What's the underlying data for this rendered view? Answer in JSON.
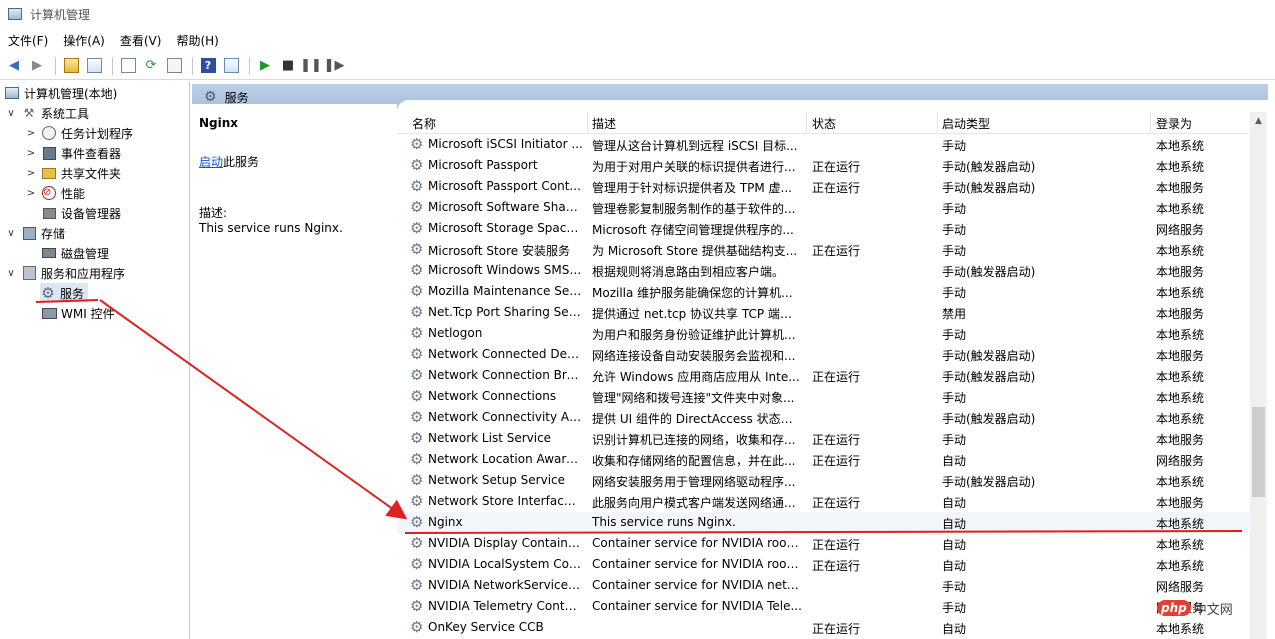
{
  "window": {
    "title": "计算机管理"
  },
  "menu": [
    "文件(F)",
    "操作(A)",
    "查看(V)",
    "帮助(H)"
  ],
  "tree": {
    "root": "计算机管理(本地)",
    "system_tools": "系统工具",
    "task_scheduler": "任务计划程序",
    "event_viewer": "事件查看器",
    "shared_folders": "共享文件夹",
    "performance": "性能",
    "device_manager": "设备管理器",
    "storage": "存储",
    "disk_management": "磁盘管理",
    "services_apps": "服务和应用程序",
    "services": "服务",
    "wmi": "WMI 控件"
  },
  "panel_header": "服务",
  "details": {
    "service_name": "Nginx",
    "start_link": "启动",
    "start_suffix": "此服务",
    "desc_label": "描述:",
    "desc_text": "This service runs Nginx."
  },
  "columns": {
    "name": "名称",
    "desc": "描述",
    "status": "状态",
    "startup": "启动类型",
    "logon": "登录为"
  },
  "services": [
    {
      "name": "Microsoft iSCSI Initiator ...",
      "desc": "管理从这台计算机到远程 iSCSI 目标...",
      "status": "",
      "startup": "手动",
      "logon": "本地系统"
    },
    {
      "name": "Microsoft Passport",
      "desc": "为用于对用户关联的标识提供者进行...",
      "status": "正在运行",
      "startup": "手动(触发器启动)",
      "logon": "本地系统"
    },
    {
      "name": "Microsoft Passport Cont...",
      "desc": "管理用于针对标识提供者及 TPM 虚...",
      "status": "正在运行",
      "startup": "手动(触发器启动)",
      "logon": "本地服务"
    },
    {
      "name": "Microsoft Software Shad...",
      "desc": "管理卷影复制服务制作的基于软件的...",
      "status": "",
      "startup": "手动",
      "logon": "本地系统"
    },
    {
      "name": "Microsoft Storage Space...",
      "desc": "Microsoft 存储空间管理提供程序的...",
      "status": "",
      "startup": "手动",
      "logon": "网络服务"
    },
    {
      "name": "Microsoft Store 安装服务",
      "desc": "为 Microsoft Store 提供基础结构支...",
      "status": "正在运行",
      "startup": "手动",
      "logon": "本地系统"
    },
    {
      "name": "Microsoft Windows SMS ...",
      "desc": "根据规则将消息路由到相应客户端。",
      "status": "",
      "startup": "手动(触发器启动)",
      "logon": "本地服务"
    },
    {
      "name": "Mozilla Maintenance Ser...",
      "desc": "Mozilla 维护服务能确保您的计算机...",
      "status": "",
      "startup": "手动",
      "logon": "本地系统"
    },
    {
      "name": "Net.Tcp Port Sharing Ser...",
      "desc": "提供通过 net.tcp 协议共享 TCP 端口...",
      "status": "",
      "startup": "禁用",
      "logon": "本地服务"
    },
    {
      "name": "Netlogon",
      "desc": "为用户和服务身份验证维护此计算机...",
      "status": "",
      "startup": "手动",
      "logon": "本地系统"
    },
    {
      "name": "Network Connected Devi...",
      "desc": "网络连接设备自动安装服务会监视和...",
      "status": "",
      "startup": "手动(触发器启动)",
      "logon": "本地服务"
    },
    {
      "name": "Network Connection Bro...",
      "desc": "允许 Windows 应用商店应用从 Inte...",
      "status": "正在运行",
      "startup": "手动(触发器启动)",
      "logon": "本地系统"
    },
    {
      "name": "Network Connections",
      "desc": "管理\"网络和拨号连接\"文件夹中对象...",
      "status": "",
      "startup": "手动",
      "logon": "本地系统"
    },
    {
      "name": "Network Connectivity Ass...",
      "desc": "提供 UI 组件的 DirectAccess 状态通...",
      "status": "",
      "startup": "手动(触发器启动)",
      "logon": "本地系统"
    },
    {
      "name": "Network List Service",
      "desc": "识别计算机已连接的网络，收集和存...",
      "status": "正在运行",
      "startup": "手动",
      "logon": "本地服务"
    },
    {
      "name": "Network Location Aware...",
      "desc": "收集和存储网络的配置信息，并在此...",
      "status": "正在运行",
      "startup": "自动",
      "logon": "网络服务"
    },
    {
      "name": "Network Setup Service",
      "desc": "网络安装服务用于管理网络驱动程序...",
      "status": "",
      "startup": "手动(触发器启动)",
      "logon": "本地系统"
    },
    {
      "name": "Network Store Interface ...",
      "desc": "此服务向用户模式客户端发送网络通...",
      "status": "正在运行",
      "startup": "自动",
      "logon": "本地服务"
    },
    {
      "name": "Nginx",
      "desc": "This service runs Nginx.",
      "status": "",
      "startup": "自动",
      "logon": "本地系统"
    },
    {
      "name": "NVIDIA Display Containe...",
      "desc": "Container service for NVIDIA root...",
      "status": "正在运行",
      "startup": "自动",
      "logon": "本地系统"
    },
    {
      "name": "NVIDIA LocalSystem Con...",
      "desc": "Container service for NVIDIA root...",
      "status": "正在运行",
      "startup": "自动",
      "logon": "本地系统"
    },
    {
      "name": "NVIDIA NetworkService ...",
      "desc": "Container service for NVIDIA netw...",
      "status": "",
      "startup": "手动",
      "logon": "网络服务"
    },
    {
      "name": "NVIDIA Telemetry Contai...",
      "desc": "Container service for NVIDIA Tele...",
      "status": "",
      "startup": "手动",
      "logon": "网络服务"
    },
    {
      "name": "OnKey Service CCB",
      "desc": "",
      "status": "正在运行",
      "startup": "自动",
      "logon": "本地系统"
    }
  ],
  "watermark": {
    "badge": "php",
    "text": "中文网"
  },
  "colors": {
    "accent_header": "#a7bedb",
    "annotation": "#e02020",
    "link": "#1a55c8"
  }
}
